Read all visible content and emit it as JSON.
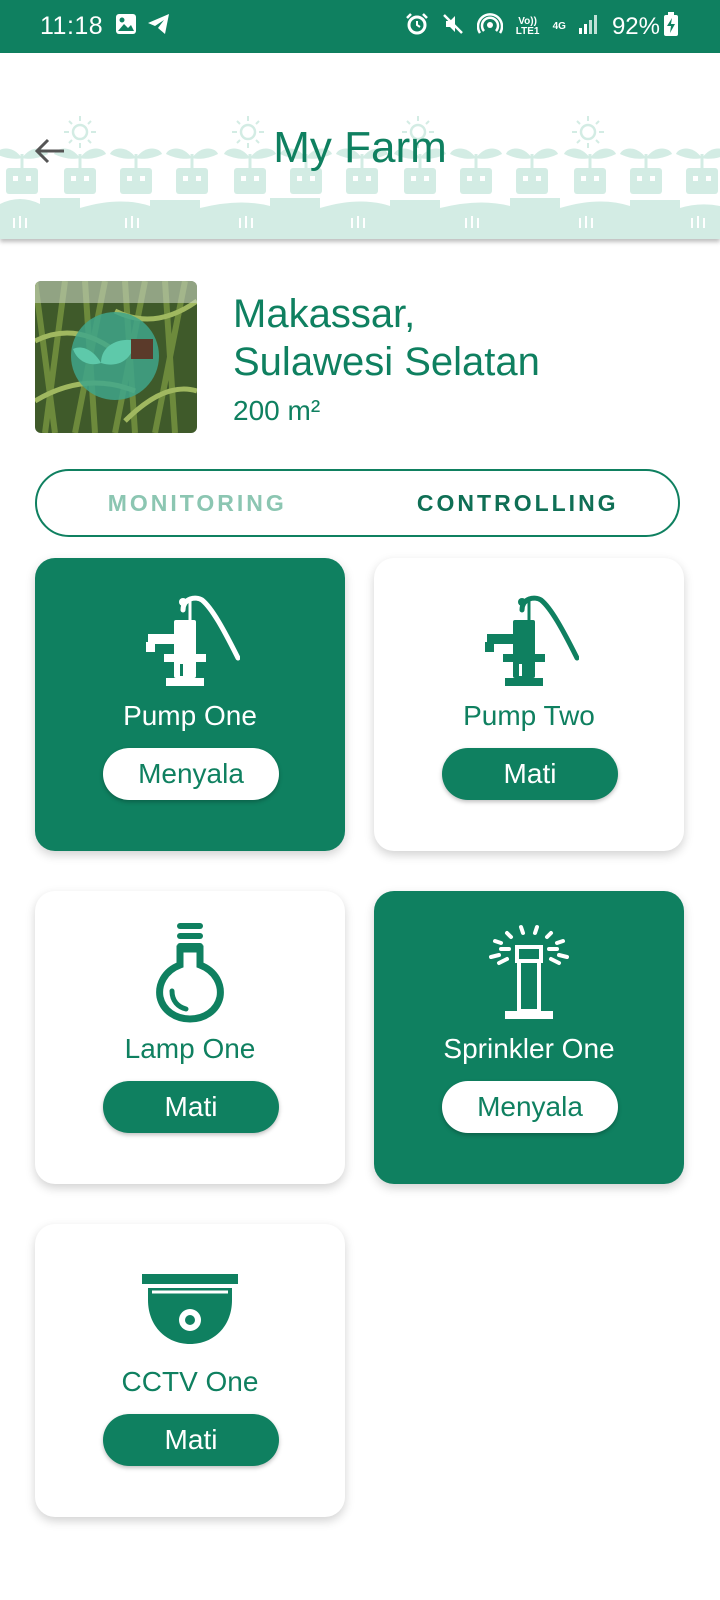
{
  "status_bar": {
    "time": "11:18",
    "volte_label": "Vo)) LTE1",
    "network": "4G",
    "battery": "92%",
    "icons": [
      "gallery-icon",
      "telegram-icon",
      "alarm-icon",
      "mute-icon",
      "hotspot-icon",
      "signal-icon",
      "battery-charging-icon"
    ]
  },
  "header": {
    "title": "My Farm",
    "back_icon": "arrow-left-icon"
  },
  "farm": {
    "location_line1": "Makassar,",
    "location_line2": "Sulawesi Selatan",
    "area": "200 m²"
  },
  "tabs": [
    {
      "label": "MONITORING",
      "active": false
    },
    {
      "label": "CONTROLLING",
      "active": true
    }
  ],
  "devices": [
    {
      "name": "Pump One",
      "status": "Menyala",
      "on": true,
      "icon": "water-pump-icon"
    },
    {
      "name": "Pump Two",
      "status": "Mati",
      "on": false,
      "icon": "water-pump-icon"
    },
    {
      "name": "Lamp One",
      "status": "Mati",
      "on": false,
      "icon": "lightbulb-icon"
    },
    {
      "name": "Sprinkler One",
      "status": "Menyala",
      "on": true,
      "icon": "sprinkler-icon"
    },
    {
      "name": "CCTV One",
      "status": "Mati",
      "on": false,
      "icon": "cctv-camera-icon"
    }
  ],
  "colors": {
    "primary": "#0f8060",
    "tab_inactive": "#8cc6b2",
    "header_pattern": "#d3ece4",
    "background": "#ffffff"
  }
}
